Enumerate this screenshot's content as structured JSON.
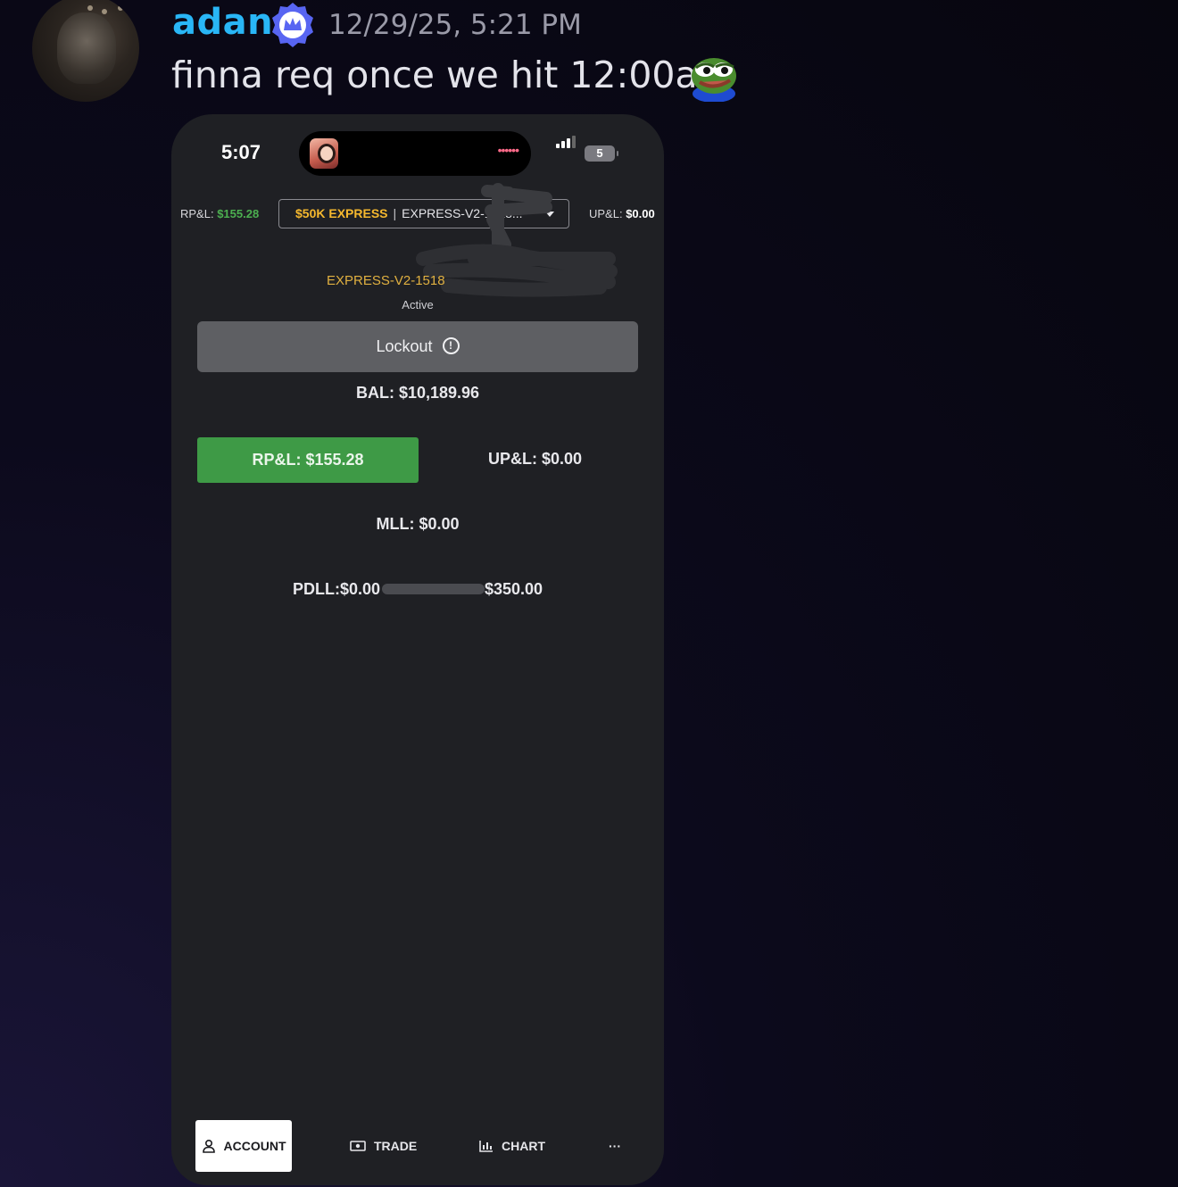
{
  "message": {
    "username": "adan",
    "timestamp": "12/29/25, 5:21 PM",
    "text": "finna req once we hit 12:00am",
    "username_color": "#29b6f6",
    "badge_icon": "crown-badge-icon",
    "emoji": "pepe-emoji-icon"
  },
  "screenshot": {
    "status_bar": {
      "time": "5:07",
      "battery": "5"
    },
    "top_bar": {
      "rpl_label": "RP&L:",
      "rpl_value": "$155.28",
      "upl_label": "UP&L:",
      "upl_value": "$0.00",
      "account_plan": "$50K EXPRESS",
      "account_separator": "|",
      "account_id": "EXPRESS-V2-1518..."
    },
    "account": {
      "id": "EXPRESS-V2-1518",
      "status": "Active",
      "lockout_label": "Lockout",
      "balance": "BAL: $10,189.96",
      "rpl_button": "RP&L: $155.28",
      "upl": "UP&L: $0.00",
      "mll": "MLL: $0.00",
      "pdll_left": "PDLL:$0.00",
      "pdll_right": "$350.00",
      "pdll_progress": 0
    },
    "nav": {
      "account": "ACCOUNT",
      "trade": "TRADE",
      "chart": "CHART",
      "more": "···"
    },
    "colors": {
      "positive": "#4caf50",
      "plan_accent": "#f5b82e",
      "rpl_button": "#3e9a46",
      "phone_bg": "#1f2024"
    }
  }
}
